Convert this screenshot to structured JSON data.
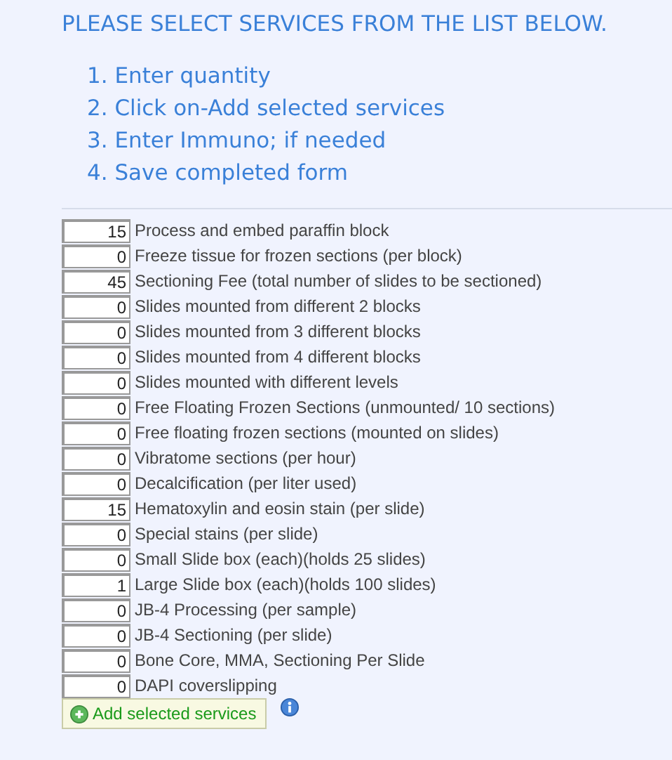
{
  "heading": "PLEASE SELECT SERVICES FROM THE LIST BELOW.",
  "steps": [
    "1. Enter quantity",
    "2. Click on-Add selected services",
    "3. Enter Immuno; if needed",
    "4. Save completed form"
  ],
  "services": [
    {
      "quantity": "15",
      "name": "Process and embed paraffin block"
    },
    {
      "quantity": "0",
      "name": "Freeze tissue for frozen sections (per block)"
    },
    {
      "quantity": "45",
      "name": "Sectioning Fee (total number of slides to be sectioned)"
    },
    {
      "quantity": "0",
      "name": "Slides mounted from different 2 blocks"
    },
    {
      "quantity": "0",
      "name": "Slides mounted from 3 different blocks"
    },
    {
      "quantity": "0",
      "name": "Slides mounted from 4 different blocks"
    },
    {
      "quantity": "0",
      "name": "Slides mounted with different levels"
    },
    {
      "quantity": "0",
      "name": "Free Floating Frozen Sections (unmounted/ 10 sections)"
    },
    {
      "quantity": "0",
      "name": "Free floating frozen sections (mounted on slides)"
    },
    {
      "quantity": "0",
      "name": "Vibratome sections (per hour)"
    },
    {
      "quantity": "0",
      "name": "Decalcification (per liter used)"
    },
    {
      "quantity": "15",
      "name": "Hematoxylin and eosin stain (per slide)"
    },
    {
      "quantity": "0",
      "name": "Special stains (per slide)"
    },
    {
      "quantity": "0",
      "name": "Small Slide box (each)(holds 25 slides)"
    },
    {
      "quantity": "1",
      "name": "Large Slide box (each)(holds 100 slides)"
    },
    {
      "quantity": "0",
      "name": "JB-4 Processing (per sample)"
    },
    {
      "quantity": "0",
      "name": "JB-4 Sectioning (per slide)"
    },
    {
      "quantity": "0",
      "name": "Bone Core, MMA, Sectioning Per Slide"
    },
    {
      "quantity": "0",
      "name": "DAPI coverslipping"
    }
  ],
  "add_button": "Add selected services"
}
